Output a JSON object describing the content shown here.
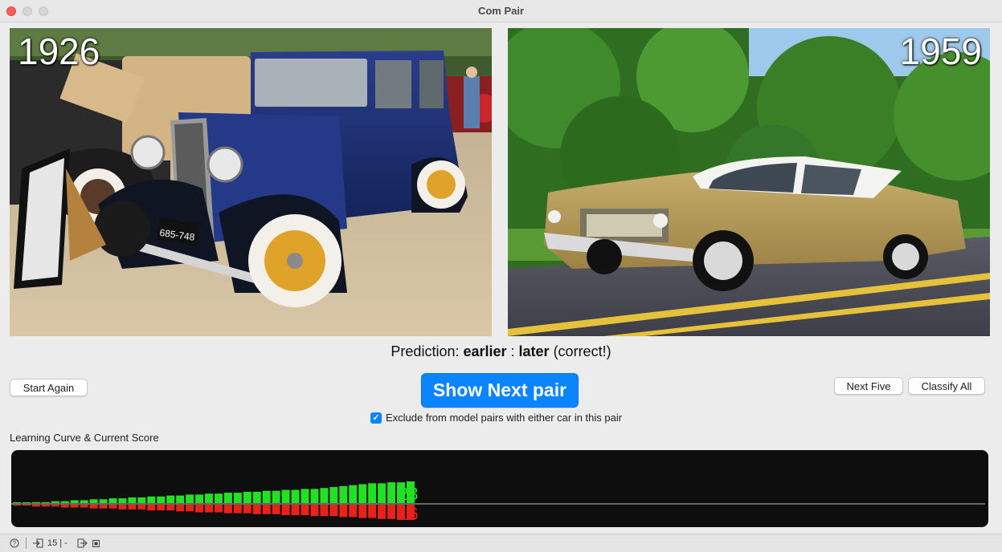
{
  "window": {
    "title": "Com Pair"
  },
  "left_image": {
    "year": "1926",
    "plate": "685-748"
  },
  "right_image": {
    "year": "1959"
  },
  "prediction": {
    "prefix": "Prediction: ",
    "first": "earlier",
    "separator": " : ",
    "second": "later",
    "result": " (correct!)"
  },
  "buttons": {
    "start_again": "Start Again",
    "show_next_pair": "Show Next pair",
    "next_five": "Next Five",
    "classify_all": "Classify All"
  },
  "exclude_checkbox": {
    "checked": true,
    "label": "Exclude from model pairs with either car in this pair"
  },
  "learning_curve": {
    "label": "Learning Curve & Current Score",
    "correct_score": "23",
    "incorrect_score": "16",
    "correct_color": "#22e022",
    "incorrect_color": "#e8211a"
  },
  "chart_data": {
    "type": "bar",
    "series": [
      {
        "name": "",
        "values": [
          0,
          0,
          1,
          1,
          2,
          2,
          3,
          3,
          4,
          4,
          5,
          5,
          6,
          6,
          7,
          7,
          8,
          8,
          9,
          9,
          10,
          10,
          11,
          11,
          12,
          12,
          13,
          13,
          14,
          14,
          15,
          15,
          16,
          17,
          18,
          19,
          20,
          21,
          21,
          22,
          22,
          23
        ]
      },
      {
        "name": "",
        "values": [
          1,
          1,
          2,
          2,
          2,
          3,
          3,
          3,
          4,
          4,
          4,
          5,
          5,
          5,
          6,
          6,
          6,
          7,
          7,
          8,
          8,
          8,
          9,
          9,
          9,
          10,
          10,
          10,
          11,
          11,
          11,
          12,
          12,
          12,
          13,
          13,
          14,
          14,
          15,
          15,
          16,
          16
        ]
      }
    ]
  },
  "statusbar": {
    "count": "15 | -"
  }
}
